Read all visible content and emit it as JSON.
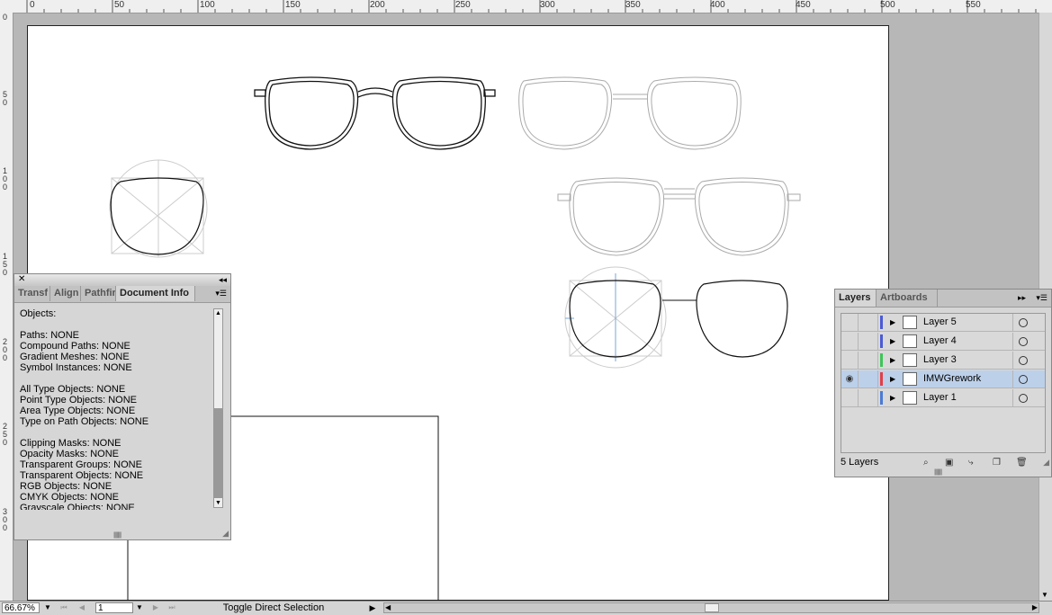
{
  "ruler": {
    "top_labels": [
      "0",
      "50",
      "100",
      "150",
      "200",
      "250",
      "300",
      "350",
      "400",
      "450",
      "500",
      "550"
    ],
    "left_labels": [
      "0",
      "50",
      "100",
      "150",
      "200",
      "250",
      "300"
    ]
  },
  "status": {
    "zoom": "66.67%",
    "page": "1",
    "tool_text": "Toggle Direct Selection"
  },
  "doc_panel": {
    "tabs": [
      "Transf",
      "Align",
      "Pathfir",
      "Document Info"
    ],
    "lines": [
      "Objects:",
      "",
      "Paths: NONE",
      "Compound Paths: NONE",
      "Gradient Meshes: NONE",
      "Symbol Instances: NONE",
      "",
      "All Type Objects: NONE",
      "Point Type Objects: NONE",
      "Area Type Objects: NONE",
      "Type on Path Objects: NONE",
      "",
      "Clipping Masks: NONE",
      "Opacity Masks: NONE",
      "Transparent Groups: NONE",
      "Transparent Objects: NONE",
      "RGB Objects: NONE",
      "CMYK Objects: NONE",
      "Grayscale Objects: NONE"
    ]
  },
  "layers_panel": {
    "tabs": [
      "Layers",
      "Artboards"
    ],
    "layers": [
      {
        "name": "Layer 5",
        "color": "#4b5bd6",
        "visible": false,
        "selected": false
      },
      {
        "name": "Layer 4",
        "color": "#4b5bd6",
        "visible": false,
        "selected": false
      },
      {
        "name": "Layer 3",
        "color": "#3fc45a",
        "visible": false,
        "selected": false
      },
      {
        "name": "IMWGrework",
        "color": "#e0404a",
        "visible": true,
        "selected": true
      },
      {
        "name": "Layer 1",
        "color": "#4b7bd6",
        "visible": false,
        "selected": false
      }
    ],
    "count_label": "5 Layers"
  },
  "icons": {
    "eye": "eye-icon",
    "expand": "triangle-right-icon",
    "target": "target-circle-icon"
  }
}
